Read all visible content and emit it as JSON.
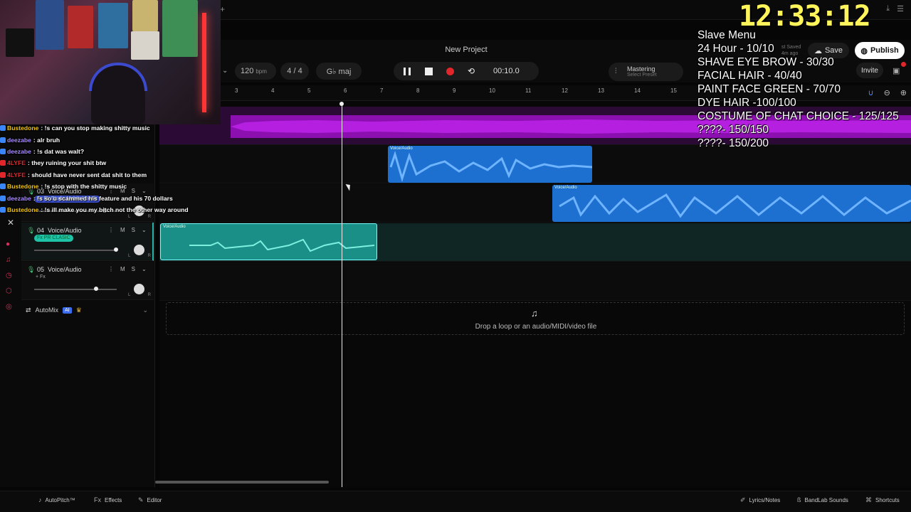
{
  "app": {
    "project_title": "New Project",
    "bpm": "120",
    "bpm_unit": "bpm",
    "time_signature": "4 / 4",
    "key": "G♭ maj",
    "time": "00:10.0",
    "mastering_title": "Mastering",
    "mastering_sub": "Select Preset",
    "save_label": "Save",
    "publish_label": "Publish",
    "invite_label": "Invite",
    "last_saved": "st Saved",
    "last_saved_ago": "4m ago"
  },
  "ruler": [
    "3",
    "4",
    "5",
    "6",
    "7",
    "8",
    "9",
    "10",
    "11",
    "12",
    "13",
    "14",
    "15"
  ],
  "tracks": [
    {
      "num": "03",
      "name": "Voice/Audio",
      "fx": "Fx FL Studio Mobile Vocals"
    },
    {
      "num": "04",
      "name": "Voice/Audio",
      "fx": "Fx PR CLASIC"
    },
    {
      "num": "05",
      "name": "Voice/Audio",
      "fx": "+ Fx"
    }
  ],
  "track_controls": {
    "mute": "M",
    "solo": "S",
    "pan_l": "L",
    "pan_r": "R"
  },
  "levels": {
    "track_03_fader": 0.0,
    "track_04_fader": 0.98,
    "track_05_fader": 0.75
  },
  "automix": {
    "label": "AutoMix",
    "badge": "AI"
  },
  "clips": [
    {
      "label": "Voice/Audio"
    },
    {
      "label": "Voice/Audio"
    },
    {
      "label": "Voice/Audio"
    }
  ],
  "drop_zone": "Drop a loop or an audio/MIDI/video file",
  "bottom_bar": {
    "autopitch": "AutoPitch™",
    "effects": "Effects",
    "editor": "Editor",
    "lyrics": "Lyrics/Notes",
    "sounds": "BandLab Sounds",
    "shortcuts": "Shortcuts"
  },
  "chat": [
    {
      "user": "Bustedone",
      "color": "#f1c40f",
      "msg": ": !s can you stop making shitty music"
    },
    {
      "user": "deezabe",
      "color": "#a78bfa",
      "msg": ": alr bruh"
    },
    {
      "user": "deezabe",
      "color": "#a78bfa",
      "msg": ": !s dat was walt?"
    },
    {
      "user": "4LYFE",
      "color": "#e3262b",
      "msg": ": they ruining your shit btw"
    },
    {
      "user": "4LYFE",
      "color": "#e3262b",
      "msg": ": should have never sent dat shit to them"
    },
    {
      "user": "Bustedone",
      "color": "#f1c40f",
      "msg": ": !s stop with the shitty music"
    },
    {
      "user": "deezabe",
      "color": "#a78bfa",
      "msg": ": !s so u scammed his feature and his 70 dollars"
    },
    {
      "user": "Bustedone",
      "color": "#f1c40f",
      "msg": ": !s ill make you my bitch not the other way around"
    }
  ],
  "overlay": {
    "clock": "12:33:12",
    "menu": [
      "Slave Menu",
      "24 Hour - 10/10",
      "SHAVE EYE BROW - 30/30",
      "FACIAL HAIR - 40/40",
      "PAINT FACE GREEN - 70/70",
      "DYE HAIR -100/100",
      "COSTUME OF CHAT CHOICE - 125/125",
      "????- 150/150",
      "????- 150/200"
    ]
  },
  "colors": {
    "accent_teal": "#1ec3a8",
    "clip_purple": "#8c0fb0",
    "clip_blue": "#1d6fd0",
    "record_red": "#e3262b",
    "clock_yellow": "#fff45a"
  }
}
